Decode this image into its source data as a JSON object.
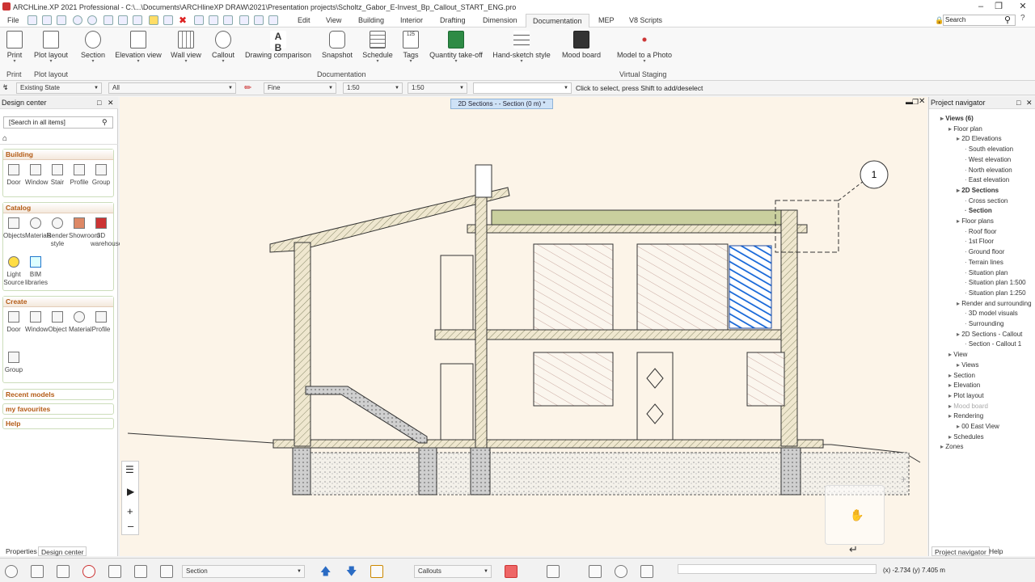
{
  "window": {
    "title": "ARCHLine.XP 2021  Professional - C:\\...\\Documents\\ARCHlineXP DRAW\\2021\\Presentation projects\\Scholtz_Gabor_E-Invest_Bp_Callout_START_ENG.pro"
  },
  "menu": {
    "items": [
      "File",
      "Edit",
      "View",
      "Building",
      "Interior",
      "Drafting",
      "Dimension",
      "Documentation",
      "MEP",
      "V8 Scripts"
    ],
    "active": "Documentation"
  },
  "search": {
    "placeholder": "Search"
  },
  "ribbon": {
    "buttons": [
      {
        "label": "Print",
        "icon": "printer-icon"
      },
      {
        "label": "Plot layout",
        "icon": "plot-layout-icon"
      },
      {
        "label": "Section",
        "icon": "section-icon"
      },
      {
        "label": "Elevation view",
        "icon": "elevation-icon"
      },
      {
        "label": "Wall view",
        "icon": "wall-view-icon"
      },
      {
        "label": "Callout",
        "icon": "callout-icon"
      },
      {
        "label": "Drawing comparison",
        "icon": "drawing-comparison-icon"
      },
      {
        "label": "Snapshot",
        "icon": "camera-icon"
      },
      {
        "label": "Schedule",
        "icon": "schedule-icon"
      },
      {
        "label": "Tags",
        "icon": "tags-icon",
        "badge": "125"
      },
      {
        "label": "Quantity take-off",
        "icon": "excel-icon"
      },
      {
        "label": "Hand-sketch style",
        "icon": "hand-sketch-icon"
      },
      {
        "label": "Mood board",
        "icon": "mood-board-icon"
      },
      {
        "label": "Model to a Photo",
        "icon": "model-to-photo-icon"
      }
    ],
    "groups": [
      "Print",
      "Plot layout",
      "Documentation",
      "Virtual Staging"
    ]
  },
  "options": {
    "state": "Existing State",
    "layer": "All",
    "line_style": "Fine",
    "scale1": "1:50",
    "scale2": "1:50",
    "hint": "Click to select, press Shift to add/deselect"
  },
  "left": {
    "title": "Design center",
    "search_placeholder": "[Search in all items]",
    "building": {
      "title": "Building",
      "items": [
        "Door",
        "Window",
        "Stair",
        "Profile",
        "Group"
      ]
    },
    "catalog": {
      "title": "Catalog",
      "items": [
        "Objects",
        "Materials",
        "Render style",
        "Showroom",
        "3D warehouse",
        "Light Source",
        "BIM libraries"
      ]
    },
    "create": {
      "title": "Create",
      "items": [
        "Door",
        "Window",
        "Object",
        "Material",
        "Profile",
        "Group"
      ]
    },
    "recent": "Recent models",
    "favourites": "my favourites",
    "help": "Help",
    "tabs": [
      "Properties",
      "Design center"
    ]
  },
  "viewport": {
    "tab": "2D Sections -  - Section (0 m) *",
    "callout_number": "1"
  },
  "navigator": {
    "title": "Project navigator",
    "items": [
      {
        "label": "Views (6)",
        "level": 0,
        "bold": true
      },
      {
        "label": "Floor plan",
        "level": 1
      },
      {
        "label": "2D Elevations",
        "level": 2
      },
      {
        "label": "South elevation",
        "level": 3
      },
      {
        "label": "West elevation",
        "level": 3
      },
      {
        "label": "North elevation",
        "level": 3
      },
      {
        "label": "East elevation",
        "level": 3
      },
      {
        "label": "2D Sections",
        "level": 2,
        "bold": true
      },
      {
        "label": "Cross section",
        "level": 3
      },
      {
        "label": "Section",
        "level": 3,
        "bold": true
      },
      {
        "label": "Floor plans",
        "level": 2
      },
      {
        "label": "Roof floor",
        "level": 3
      },
      {
        "label": "1st Floor",
        "level": 3
      },
      {
        "label": "Ground floor",
        "level": 3
      },
      {
        "label": "Terrain lines",
        "level": 3
      },
      {
        "label": "Situation plan",
        "level": 3
      },
      {
        "label": "Situation plan 1:500",
        "level": 3
      },
      {
        "label": "Situation plan 1:250",
        "level": 3
      },
      {
        "label": "Render and surrounding",
        "level": 2
      },
      {
        "label": "3D model visuals",
        "level": 3
      },
      {
        "label": "Surrounding",
        "level": 3
      },
      {
        "label": "2D Sections - Callout",
        "level": 2
      },
      {
        "label": "Section - Callout 1",
        "level": 3
      },
      {
        "label": "View",
        "level": 1
      },
      {
        "label": "Views",
        "level": 2
      },
      {
        "label": "Section",
        "level": 1
      },
      {
        "label": "Elevation",
        "level": 1
      },
      {
        "label": "Plot layout",
        "level": 1
      },
      {
        "label": "Mood board",
        "level": 1,
        "grey": true
      },
      {
        "label": "Rendering",
        "level": 1
      },
      {
        "label": "00 East View",
        "level": 2
      },
      {
        "label": "Schedules",
        "level": 1
      },
      {
        "label": "Zones",
        "level": 0
      }
    ],
    "tabs": [
      "Project navigator",
      "Help"
    ]
  },
  "status": {
    "view_combo": "Section",
    "callouts_combo": "Callouts",
    "coords": "(x) -2.734  (y) 7.405 m"
  }
}
